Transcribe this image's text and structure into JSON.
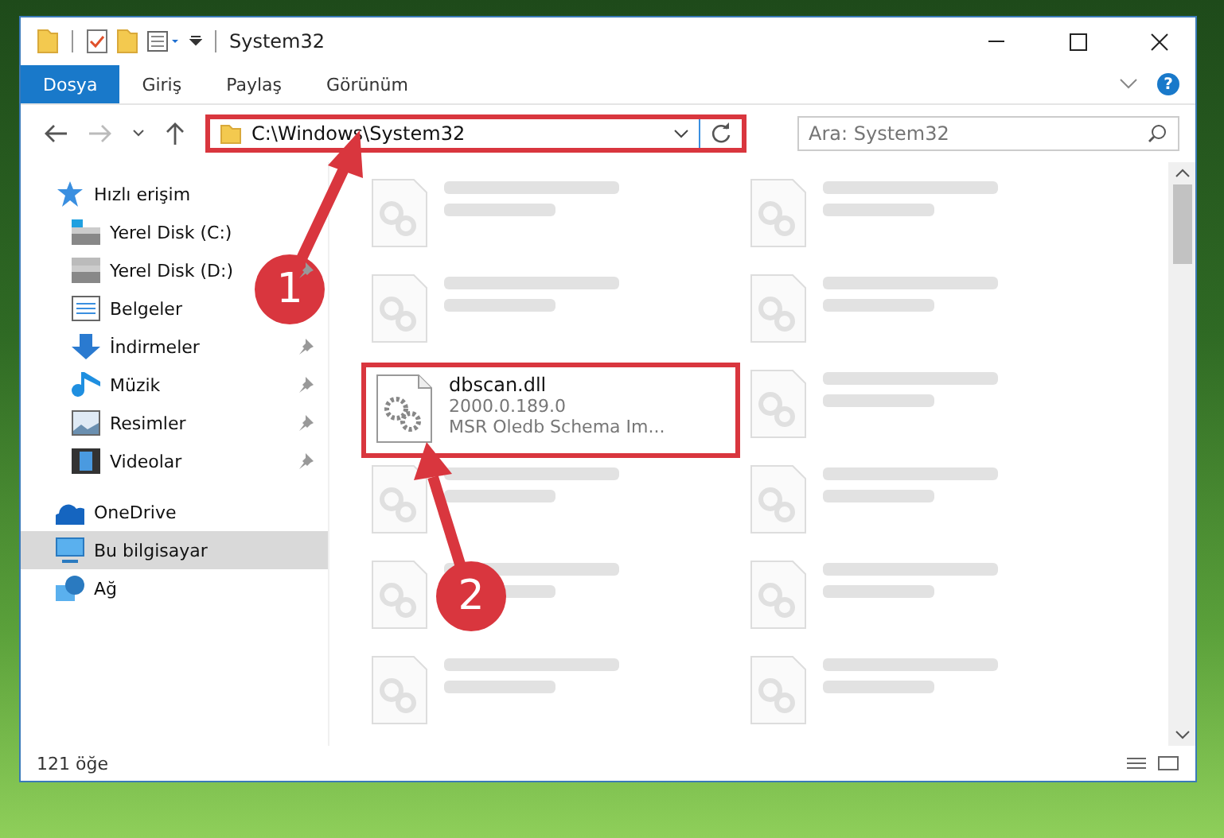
{
  "window": {
    "title": "System32"
  },
  "ribbon": {
    "tabs": [
      {
        "label": "Dosya",
        "selected": true
      },
      {
        "label": "Giriş",
        "selected": false
      },
      {
        "label": "Paylaş",
        "selected": false
      },
      {
        "label": "Görünüm",
        "selected": false
      }
    ],
    "help": "?"
  },
  "address_bar": {
    "path": "C:\\Windows\\System32",
    "highlighted": true
  },
  "search": {
    "placeholder": "Ara: System32"
  },
  "sidebar": {
    "items": [
      {
        "label": "Hızlı erişim",
        "kind": "star",
        "selected": false,
        "children": [
          {
            "label": "Yerel Disk (C:)",
            "kind": "drive-c",
            "selected": false,
            "pinned": false
          },
          {
            "label": "Yerel Disk (D:)",
            "kind": "drive",
            "selected": false,
            "pinned": true
          },
          {
            "label": "Belgeler",
            "kind": "document",
            "selected": false
          },
          {
            "label": "İndirmeler",
            "kind": "download",
            "selected": false,
            "pinned": true
          },
          {
            "label": "Müzik",
            "kind": "music",
            "selected": false,
            "pinned": true
          },
          {
            "label": "Resimler",
            "kind": "picture",
            "selected": false,
            "pinned": true
          },
          {
            "label": "Videolar",
            "kind": "video",
            "selected": false,
            "pinned": true
          }
        ]
      },
      {
        "label": "OneDrive",
        "kind": "cloud",
        "selected": false
      },
      {
        "label": "Bu bilgisayar",
        "kind": "computer",
        "selected": true
      },
      {
        "label": "Ağ",
        "kind": "network",
        "selected": false
      }
    ]
  },
  "files": [
    {
      "kind": "obscured"
    },
    {
      "kind": "obscured"
    },
    {
      "kind": "obscured"
    },
    {
      "kind": "obscured"
    },
    {
      "kind": "file",
      "name": "dbscan.dll",
      "lines": [
        "2000.0.189.0",
        "MSR Oledb Schema Im..."
      ],
      "highlighted": true
    },
    {
      "kind": "obscured"
    },
    {
      "kind": "obscured"
    },
    {
      "kind": "obscured"
    },
    {
      "kind": "obscured"
    },
    {
      "kind": "obscured"
    },
    {
      "kind": "obscured"
    },
    {
      "kind": "obscured"
    }
  ],
  "status_bar": {
    "count": "121 öğe"
  },
  "annotations": [
    {
      "label": "1"
    },
    {
      "label": "2"
    }
  ]
}
